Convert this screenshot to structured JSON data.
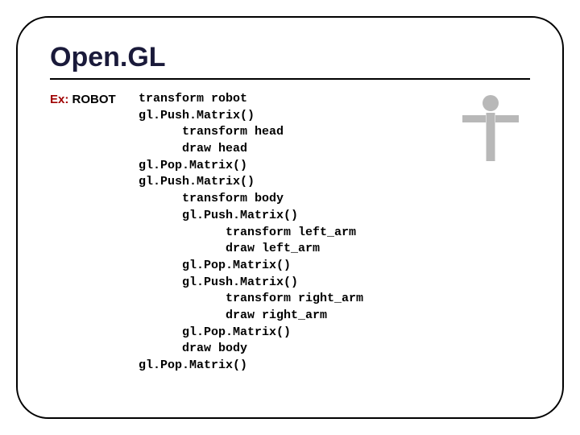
{
  "title": "Open.GL",
  "label": {
    "prefix": "Ex:",
    "main": " ROBOT"
  },
  "code": "transform robot\ngl.Push.Matrix()\n      transform head\n      draw head\ngl.Pop.Matrix()\ngl.Push.Matrix()\n      transform body\n      gl.Push.Matrix()\n            transform left_arm\n            draw left_arm\n      gl.Pop.Matrix()\n      gl.Push.Matrix()\n            transform right_arm\n            draw right_arm\n      gl.Pop.Matrix()\n      draw body\ngl.Pop.Matrix()"
}
